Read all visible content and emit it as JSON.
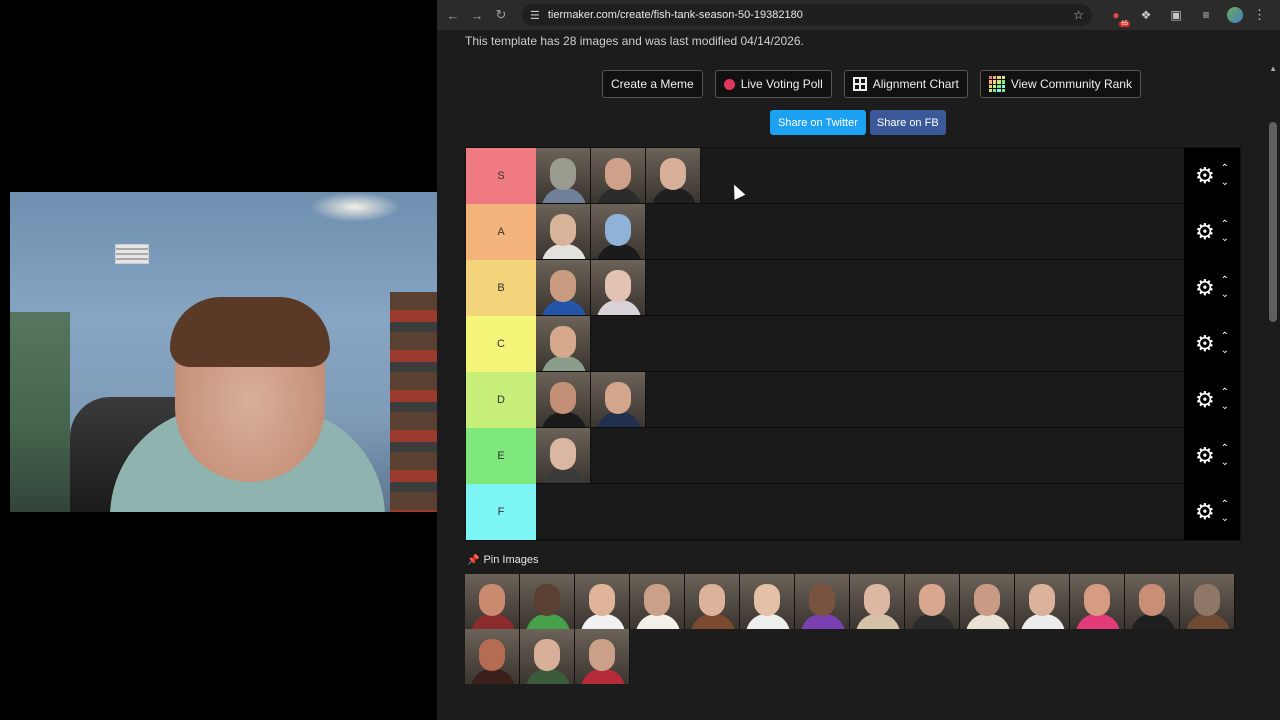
{
  "browser": {
    "url": "tiermaker.com/create/fish-tank-season-50-19382180",
    "ext_badge": "65"
  },
  "page": {
    "template_info": "This template has 28 images and was last modified 04/14/2026.",
    "buttons": {
      "create_meme": "Create a Meme",
      "live_poll": "Live Voting Poll",
      "alignment": "Alignment Chart",
      "community": "View Community Rank"
    },
    "share": {
      "twitter": "Share on Twitter",
      "fb": "Share on FB"
    },
    "tiers": [
      {
        "label": "S",
        "color": "#f07a82",
        "items": [
          [
            "#9a9b8f",
            "#6f7f9a"
          ],
          [
            "#cfa18a",
            "#2b2b2b"
          ],
          [
            "#d8b09a",
            "#1f1f1f"
          ]
        ]
      },
      {
        "label": "A",
        "color": "#f4b37a",
        "items": [
          [
            "#d7b39a",
            "#e3e1dc"
          ],
          [
            "#8fb3d8",
            "#1b1b1b"
          ]
        ]
      },
      {
        "label": "B",
        "color": "#f4d47a",
        "items": [
          [
            "#c99b80",
            "#2356a8"
          ],
          [
            "#e2c2b2",
            "#d9d2d8"
          ]
        ]
      },
      {
        "label": "C",
        "color": "#f5f57a",
        "items": [
          [
            "#d6a98d",
            "#8a9d8a"
          ]
        ]
      },
      {
        "label": "D",
        "color": "#c8ef7a",
        "items": [
          [
            "#c48f77",
            "#1a1a1a"
          ],
          [
            "#d2a58c",
            "#223050"
          ]
        ]
      },
      {
        "label": "E",
        "color": "#7ee87c",
        "items": [
          [
            "#dbb6a0",
            "#3a3a3a"
          ]
        ]
      },
      {
        "label": "F",
        "color": "#7df5f5",
        "items": []
      }
    ],
    "pin_label": "Pin Images",
    "pool": [
      [
        "#c98a6f",
        "#8b2b2b"
      ],
      [
        "#5a3f33",
        "#47a14a"
      ],
      [
        "#e0b49a",
        "#f1f1f1"
      ],
      [
        "#caa088",
        "#f3efe9"
      ],
      [
        "#dcb39a",
        "#7a4a2f"
      ],
      [
        "#e3c0a6",
        "#eeeeee"
      ],
      [
        "#7a5340",
        "#7a3fb0"
      ],
      [
        "#dcb7a2",
        "#d6c2a8"
      ],
      [
        "#d9a690",
        "#2b2b2b"
      ],
      [
        "#c99b84",
        "#e8e1d4"
      ],
      [
        "#dbb39c",
        "#ececec"
      ],
      [
        "#d69b80",
        "#e23b7a"
      ],
      [
        "#c98f76",
        "#1f1f1f"
      ],
      [
        "#8f7768",
        "#6f4b33"
      ],
      [
        "#b56c52",
        "#3a1f1a"
      ],
      [
        "#d8b09a",
        "#3b5b3b"
      ],
      [
        "#caa089",
        "#b62b3a"
      ]
    ],
    "colors": {
      "twitter": "#1da1f2",
      "fb": "#3b5998",
      "live_dot": "#e0365f"
    }
  }
}
